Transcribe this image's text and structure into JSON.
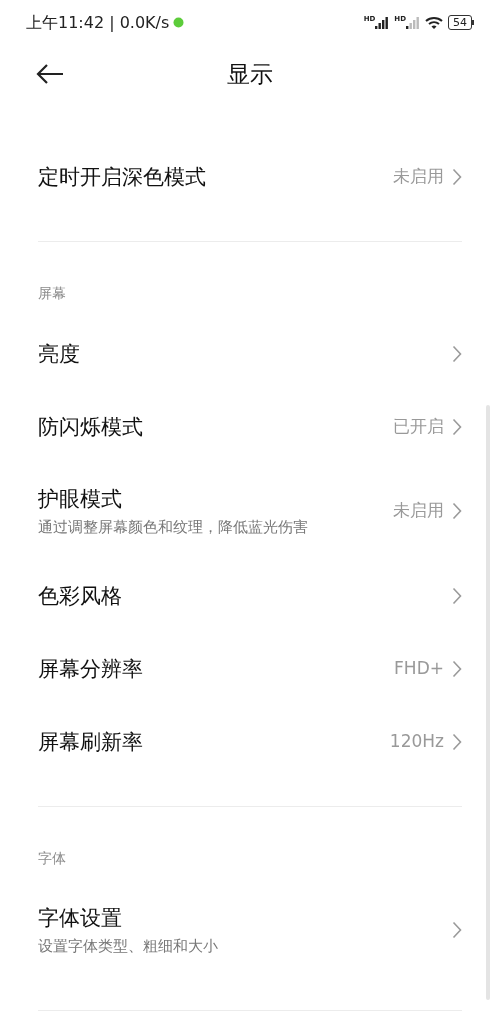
{
  "status_bar": {
    "time": "上午11:42 | 0.0K/s",
    "signals": [
      "HD",
      "HD"
    ],
    "battery": "54"
  },
  "header": {
    "title": "显示"
  },
  "top_items": [
    {
      "title": "定时开启深色模式",
      "value": "未启用"
    }
  ],
  "sections": [
    {
      "label": "屏幕",
      "items": [
        {
          "title": "亮度"
        },
        {
          "title": "防闪烁模式",
          "value": "已开启"
        },
        {
          "title": "护眼模式",
          "subtitle": "通过调整屏幕颜色和纹理，降低蓝光伤害",
          "value": "未启用"
        },
        {
          "title": "色彩风格"
        },
        {
          "title": "屏幕分辨率",
          "value": "FHD+"
        },
        {
          "title": "屏幕刷新率",
          "value": "120Hz"
        }
      ]
    },
    {
      "label": "字体",
      "items": [
        {
          "title": "字体设置",
          "subtitle": "设置字体类型、粗细和大小"
        }
      ]
    }
  ]
}
